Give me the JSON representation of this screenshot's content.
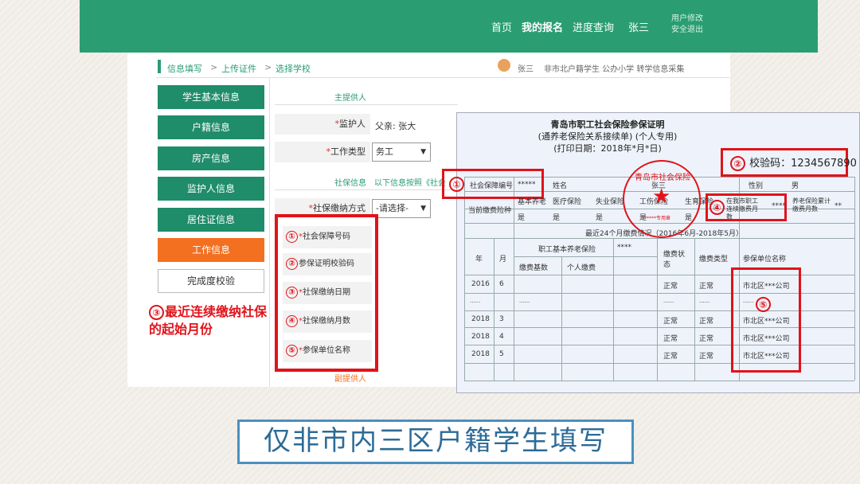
{
  "nav": {
    "items": [
      "首页",
      "我的报名",
      "进度查询"
    ],
    "active": "我的报名",
    "user": "张三",
    "user_menu": [
      "用户修改",
      "安全退出"
    ]
  },
  "breadcrumb": [
    "信息填写",
    ">",
    "上传证件",
    ">",
    "选择学校"
  ],
  "header_user": "张三",
  "header_desc": "非市北户籍学生 公办小学 转学信息采集",
  "sidebar": {
    "items": [
      "学生基本信息",
      "户籍信息",
      "房产信息",
      "监护人信息",
      "居住证信息",
      "工作信息",
      "完成度校验"
    ],
    "current": "工作信息"
  },
  "form": {
    "section_main": "主提供人",
    "guardian_label": "监护人",
    "guardian_value": "父亲: 张大",
    "worktype_label": "工作类型",
    "worktype_value": "务工",
    "section_social": "社保信息",
    "social_hint": "以下信息按照《社会",
    "paymethod_label": "社保缴纳方式",
    "paymethod_value": "-请选择-",
    "required_mark": "*",
    "bottom_link": "副提供人"
  },
  "callouts": {
    "nums": [
      "①",
      "②",
      "③",
      "④",
      "⑤"
    ],
    "items": [
      "社会保障号码",
      "参保证明校验码",
      "社保缴纳日期",
      "社保缴纳月数",
      "参保单位名称"
    ],
    "note": "最近连续缴纳社保的起始月份"
  },
  "certificate": {
    "title1": "青岛市职工社会保险参保证明",
    "title2": "(通养老保险关系接续单)  (个人专用)",
    "title3": "(打印日期：2018年*月*日)",
    "code_label": "校验码：1234567890",
    "row1": [
      "社会保障编号",
      "*****",
      "姓名",
      "张三",
      "性别",
      "男"
    ],
    "row2": [
      "当前缴费险种",
      "基本养老",
      "医疗保险",
      "失业保险",
      "工伤保险",
      "生育保险",
      "在我市职工连续缴费月数",
      "****",
      "养老保险累计缴费月数",
      "**"
    ],
    "row3": [
      "是",
      "是",
      "是",
      "是",
      "是"
    ],
    "recent": "最近24个月缴费情况（2016年6月-2018年5月）",
    "pension": "职工基本养老保险",
    "pension_val": "****",
    "heads": [
      "年",
      "月",
      "缴费基数",
      "个人缴费",
      "缴费状态",
      "缴费类型",
      "参保单位名称"
    ],
    "rows": [
      [
        "2016",
        "6",
        "正常",
        "正常",
        "市北区***公司"
      ],
      [
        "......",
        "......",
        "......",
        "......",
        "......"
      ],
      [
        "2018",
        "3",
        "正常",
        "正常",
        "市北区***公司"
      ],
      [
        "2018",
        "4",
        "正常",
        "正常",
        "市北区***公司"
      ],
      [
        "2018",
        "5",
        "正常",
        "正常",
        "市北区***公司"
      ]
    ],
    "stamp_text": "青岛市社会保险",
    "stamp_sub": "******专用章",
    "stamp_star": "★"
  },
  "banner": "仅非市内三区户籍学生填写",
  "colors": {
    "primary": "#2a9d73",
    "accent": "#f37021",
    "callout": "#e0131a",
    "banner": "#2d6b97"
  }
}
